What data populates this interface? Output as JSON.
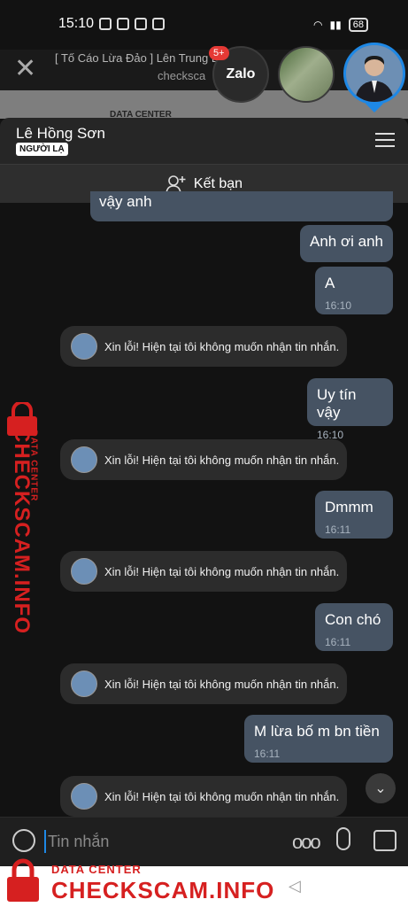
{
  "status": {
    "time": "15:10",
    "battery": "68"
  },
  "browser": {
    "close_glyph": "✕",
    "title": "[ Tố Cáo Lừa Đảo ] Lên Trung  Liệ  cam",
    "url": "checksca",
    "behind_text": "DATA CENTER"
  },
  "bubble_heads": {
    "zalo_label": "Zalo",
    "badge": "5+"
  },
  "header": {
    "name": "Lê Hồng Sơn",
    "tag": "NGƯỜI LẠ"
  },
  "add_friend": {
    "label": "Kết bạn"
  },
  "messages": {
    "partial_text": "vậy anh",
    "sent": [
      {
        "text": "Anh ơi anh",
        "time": ""
      },
      {
        "text": "A",
        "time": "16:10"
      },
      {
        "text": "Uy tín vậy",
        "time": "16:10"
      },
      {
        "text": "Dmmm",
        "time": "16:11"
      },
      {
        "text": "Con chó",
        "time": "16:11"
      },
      {
        "text": "M lừa bố m bn tiền",
        "time": "16:11"
      }
    ],
    "auto_reply": "Xin lỗi! Hiện tại tôi không muốn nhận tin nhắn."
  },
  "input": {
    "placeholder": "Tin nhắn"
  },
  "watermark": {
    "sub": "DATA CENTER",
    "main": "CHECKSCAM.INFO"
  },
  "colors": {
    "sent_bubble": "#465363",
    "auto_bubble": "#2c2c2c",
    "accent": "#1e88e5",
    "watermark": "#d62020"
  }
}
